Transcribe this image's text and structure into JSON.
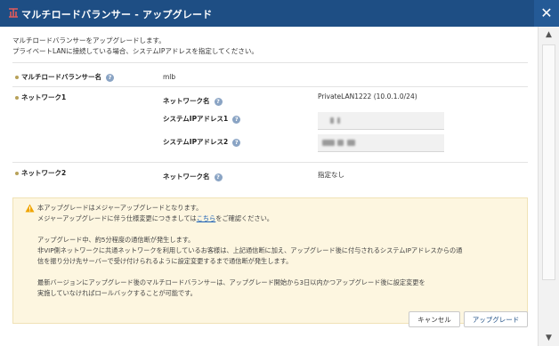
{
  "window": {
    "title": "マルチロードバランサー - アップグレード"
  },
  "intro": {
    "line1": "マルチロードバランサーをアップグレードします。",
    "line2": "プライベートLANに接続している場合、システムIPアドレスを指定してください。"
  },
  "form": {
    "mlb_name_label": "マルチロードバランサー名",
    "mlb_name_value": "mlb",
    "network1": {
      "section_label": "ネットワーク1",
      "network_name_label": "ネットワーク名",
      "network_name_value": "PrivateLAN1222 (10.0.1.0/24)",
      "system_ip1_label": "システムIPアドレス1",
      "system_ip2_label": "システムIPアドレス2"
    },
    "network2": {
      "section_label": "ネットワーク2",
      "network_name_label": "ネットワーク名",
      "network_name_value": "指定なし"
    },
    "help_glyph": "?"
  },
  "notice": {
    "line1": "本アップグレードはメジャーアップグレードとなります。",
    "line2_pre": "メジャーアップグレードに伴う仕様変更につきましては",
    "line2_link": "こちら",
    "line2_post": "をご確認ください。",
    "line3": "アップグレード中、約5分程度の通信断が発生します。",
    "line4": "非VIP側ネットワークに共通ネットワークを利用しているお客様は、上記通信断に加え、アップグレード後に付与されるシステムIPアドレスからの通",
    "line5": "信を振り分け先サーバーで受け付けられるように設定変更するまで通信断が発生します。",
    "line6": "最新バージョンにアップグレード後のマルチロードバランサーは、アップグレード開始から3日以内かつアップグレード後に設定変更を",
    "line7": "実施していなければロールバックすることが可能です。"
  },
  "buttons": {
    "cancel": "キャンセル",
    "upgrade": "アップグレード"
  },
  "colors": {
    "titlebar": "#1e4e84",
    "notice_bg": "#fdf6e0",
    "link": "#1a5fb4",
    "warning": "#f0a500"
  }
}
